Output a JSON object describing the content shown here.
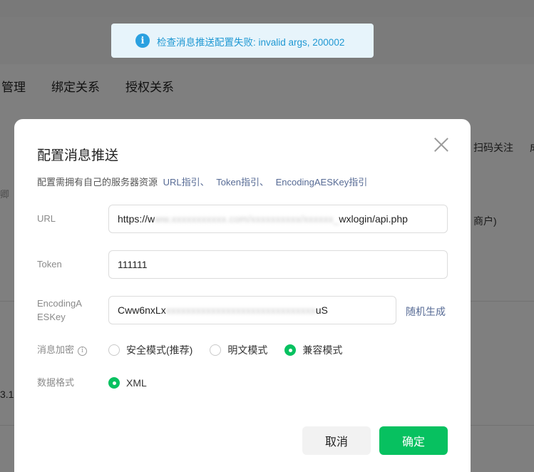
{
  "background": {
    "tabs": [
      "管理",
      "绑定关系",
      "授权关系"
    ],
    "right_text_1": "扫码关注",
    "right_text_2": "成",
    "right_text_3": "商户)",
    "left_char": "卿",
    "left_number": "3.1"
  },
  "toast": {
    "icon": "info-icon",
    "message": "检查消息推送配置失败: invalid args, 200002",
    "color": "#1f98d3"
  },
  "dialog": {
    "title": "配置消息推送",
    "description": "配置需拥有自己的服务器资源",
    "links": [
      "URL指引",
      "Token指引",
      "EncodingAESKey指引"
    ],
    "link_separator": "、",
    "fields": {
      "url": {
        "label": "URL",
        "value_prefix": "https://w",
        "value_blurred": "ww.xxxxxxxxxxx.com/xxxxxxxxxx/xxxxxx_",
        "value_suffix": "wxlogin/api.php"
      },
      "token": {
        "label": "Token",
        "value": "111111"
      },
      "aeskey": {
        "label_line1": "EncodingA",
        "label_line2": "ESKey",
        "value_prefix": "Cww6nxLx",
        "value_blurred": "xxxxxxxxxxxxxxxxxxxxxxxxxxxxxx",
        "value_suffix": "uS",
        "random_label": "随机生成"
      }
    },
    "encryption": {
      "label": "消息加密",
      "options": [
        "安全模式(推荐)",
        "明文模式",
        "兼容模式"
      ],
      "selected": "兼容模式"
    },
    "format": {
      "label": "数据格式",
      "options": [
        "XML"
      ],
      "selected": "XML"
    },
    "buttons": {
      "cancel": "取消",
      "confirm": "确定"
    }
  },
  "colors": {
    "accent": "#07c160",
    "link": "#576b95"
  }
}
